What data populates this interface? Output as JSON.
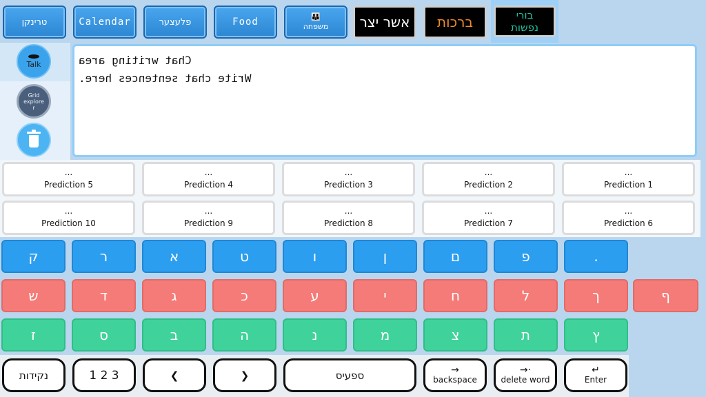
{
  "categories": [
    {
      "label": "טרינקן",
      "type": "blue"
    },
    {
      "label": "Calendar",
      "type": "blue"
    },
    {
      "label": "פלעצער",
      "type": "blue"
    },
    {
      "label": "Food",
      "type": "blue"
    },
    {
      "label": "משפחה",
      "type": "blue"
    },
    {
      "label": "אשר יצר",
      "type": "black",
      "color": "#ffffff"
    },
    {
      "label": "ברכות",
      "type": "black",
      "color": "#f08a2a"
    },
    {
      "label_line1": "בורי",
      "label_line2": "נפשות",
      "type": "selected",
      "color": "#1fc3a0"
    }
  ],
  "left": {
    "talk_label": "Talk",
    "grid_label_1": "Grid",
    "grid_label_2": "explore",
    "grid_label_3": "r"
  },
  "textarea": {
    "line1": "Chat writing area",
    "line2": "Write chat sentences here."
  },
  "predictions_row1": [
    "Prediction 5",
    "Prediction 4",
    "Prediction 3",
    "Prediction 2",
    "Prediction 1"
  ],
  "predictions_row2": [
    "Prediction 10",
    "Prediction 9",
    "Prediction 8",
    "Prediction 7",
    "Prediction 6"
  ],
  "prediction_dots": "...",
  "keys_row1": [
    "ק",
    "ר",
    "א",
    "ט",
    "ו",
    "ן",
    "ם",
    "פ",
    "."
  ],
  "keys_row2": [
    "ש",
    "ד",
    "ג",
    "כ",
    "ע",
    "י",
    "ח",
    "ל",
    "ך",
    "ף"
  ],
  "keys_row3": [
    "ז",
    "ס",
    "ב",
    "ה",
    "נ",
    "מ",
    "צ",
    "ת",
    "ץ"
  ],
  "bottom": {
    "nikud": "נקידות",
    "numbers": "1 2 3",
    "left_arrow": "❮",
    "right_arrow": "❯",
    "space": "ספעיס",
    "backspace_sym": "→",
    "backspace": "backspace",
    "delete_word_sym": "→·",
    "delete_word": "delete word",
    "enter_sym": "↵",
    "enter": "Enter"
  },
  "colors": {
    "blue_key": "#2c9ef0",
    "red_key": "#f47b78",
    "green_key": "#3fd39b"
  }
}
